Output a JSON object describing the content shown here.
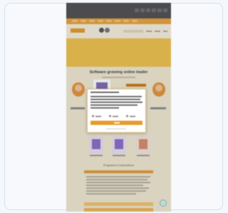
{
  "page": {
    "headline": "Software growing online leader",
    "section_title": "Programs & Instructions"
  },
  "colors": {
    "brand_orange": "#e8a23a",
    "banner_yellow": "#f0c24e",
    "topbar_dark": "#4f4f52",
    "accept_button": "#e89a2e"
  },
  "icons": [
    "logo-icon",
    "avatar-icon",
    "help-icon",
    "product-box-icon"
  ],
  "consent_modal": {
    "accept_label": ""
  }
}
